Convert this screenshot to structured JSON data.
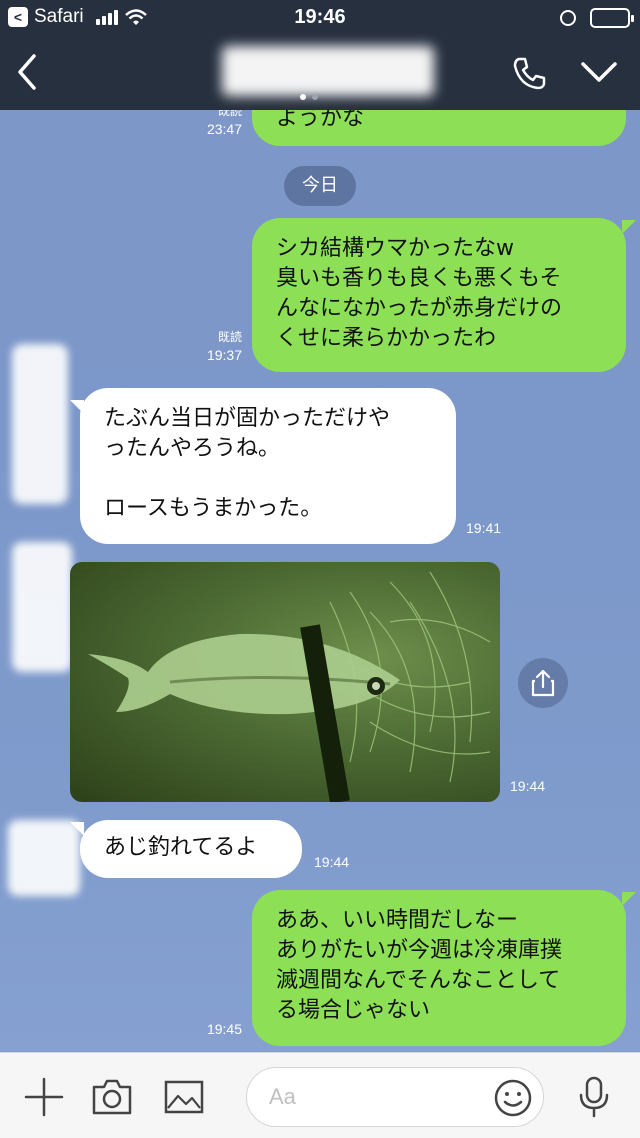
{
  "status_bar": {
    "back_app": "Safari",
    "time": "19:46"
  },
  "header": {
    "title": ""
  },
  "messages": [
    {
      "id": "m0",
      "side": "out",
      "text": "ようかな",
      "read": "既読",
      "time": "23:47"
    },
    {
      "id": "date",
      "type": "date",
      "text": "今日"
    },
    {
      "id": "m1",
      "side": "out",
      "text": "シカ結構ウマかったなw\n臭いも香りも良くも悪くもそ\nんなになかったが赤身だけの\nくせに柔らかかったわ",
      "read": "既読",
      "time": "19:37"
    },
    {
      "id": "m2",
      "side": "in",
      "text": "たぶん当日が固かっただけや\nったんやろうね。\n\nロースもうまかった。",
      "time": "19:41"
    },
    {
      "id": "m3",
      "side": "in",
      "type": "photo",
      "description": "fish",
      "time": "19:44"
    },
    {
      "id": "m4",
      "side": "in",
      "text": "あじ釣れてるよ",
      "time": "19:44"
    },
    {
      "id": "m5",
      "side": "out",
      "text": "ああ、いい時間だしなー\nありがたいが今週は冷凍庫撲\n滅週間なんでそんなことして\nる場合じゃない",
      "time": "19:45"
    }
  ],
  "input": {
    "placeholder": "Aa"
  },
  "colors": {
    "header": "#27303f",
    "bubble_out": "#8de055",
    "bubble_in": "#ffffff",
    "background": "#7d97c7"
  },
  "icons": [
    "back-icon",
    "call-icon",
    "chevron-down-icon",
    "plus-icon",
    "camera-icon",
    "image-icon",
    "emoji-icon",
    "mic-icon",
    "share-icon"
  ]
}
